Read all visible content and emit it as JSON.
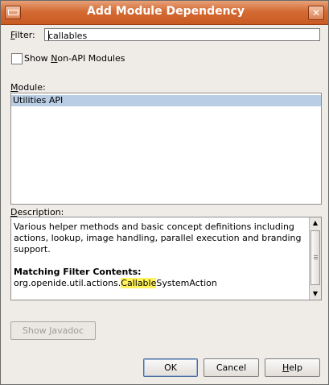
{
  "dialog": {
    "title": "Add Module Dependency",
    "close_symbol": "✕"
  },
  "filter": {
    "label_mnemonic": "F",
    "label_rest": "ilter:",
    "value": "callables"
  },
  "show_non_api": {
    "label_pre": "Show ",
    "label_mnemonic": "N",
    "label_rest": "on-API Modules",
    "checked": false
  },
  "module": {
    "label_mnemonic": "M",
    "label_rest": "odule:",
    "items": [
      "Utilities API"
    ]
  },
  "description": {
    "label_mnemonic": "D",
    "label_rest": "escription:",
    "text": "Various helper methods and basic concept definitions including actions, lookup, image handling, parallel execution and branding support.",
    "matching_heading": "Matching Filter Contents:",
    "match_prefix": "org.openide.util.actions.",
    "match_highlight": "Callable",
    "match_suffix": "SystemAction"
  },
  "buttons": {
    "show_javadoc_pre": "Show ",
    "show_javadoc_mnemonic": "J",
    "show_javadoc_rest": "avadoc",
    "ok": "OK",
    "cancel": "Cancel",
    "help_mnemonic": "H",
    "help_rest": "elp"
  },
  "colors": {
    "titlebar": "#d56b34",
    "selection": "#b9cde5",
    "highlight": "#fff25a"
  }
}
